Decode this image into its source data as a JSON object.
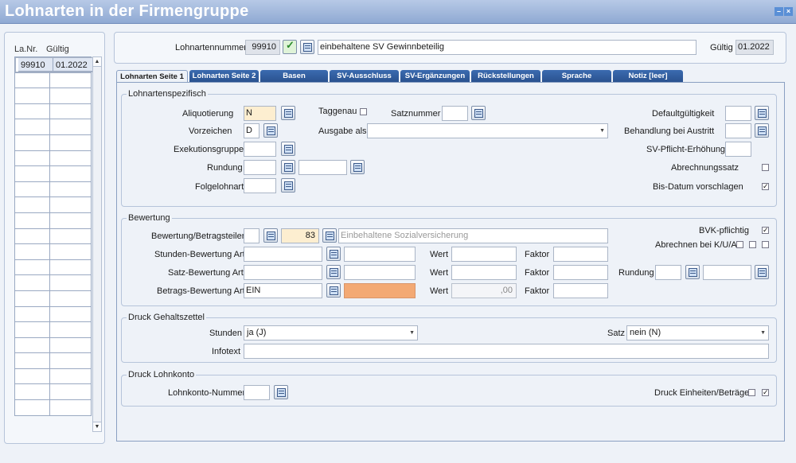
{
  "window": {
    "title": "Lohnarten in der Firmengruppe",
    "controls": [
      "–",
      "×"
    ]
  },
  "list": {
    "col1": "La.Nr.",
    "col2": "Gültig",
    "rows": [
      {
        "nr": "99910",
        "valid": "01.2022"
      }
    ]
  },
  "header": {
    "lohnartennummer_label": "Lohnartennummer",
    "nummer": "99910",
    "bezeichnung": "einbehaltene SV Gewinnbeteilig",
    "gueltig_label": "Gültig",
    "gueltig": "01.2022"
  },
  "tabs": [
    "Lohnarten Seite 1",
    "Lohnarten Seite 2",
    "Basen",
    "SV-Ausschluss",
    "SV-Ergänzungen",
    "Rückstellungen",
    "Sprache",
    "Notiz [leer]"
  ],
  "spez": {
    "title": "Lohnartenspezifisch",
    "aliquotierung_label": "Aliquotierung",
    "aliquotierung": "N",
    "vorzeichen_label": "Vorzeichen",
    "vorzeichen": "D",
    "exekution_label": "Exekutionsgruppe",
    "rundung_label": "Rundung",
    "folgelohnart_label": "Folgelohnart",
    "taggenau_label": "Taggenau",
    "satznummer_label": "Satznummer",
    "ausgabe_label": "Ausgabe als",
    "default_label": "Defaultgültigkeit",
    "austritt_label": "Behandlung bei Austritt",
    "svpflicht_label": "SV-Pflicht-Erhöhung",
    "abrechnungssatz_label": "Abrechnungssatz",
    "bisdatum_label": "Bis-Datum vorschlagen"
  },
  "bewertung": {
    "title": "Bewertung",
    "betragsteiler_label": "Bewertung/Betragsteiler",
    "betragsteiler_val": "83",
    "betragsteiler_text": "Einbehaltene Sozialversicherung",
    "stunden_label": "Stunden-Bewertung Art",
    "satz_label": "Satz-Bewertung Art",
    "betrags_label": "Betrags-Bewertung Art",
    "betrags_val": "EIN",
    "wert_label": "Wert",
    "faktor_label": "Faktor",
    "wert3": ",00",
    "bvk_label": "BVK-pflichtig",
    "kua_label": "Abrechnen bei K/U/A",
    "rundung_label": "Rundung"
  },
  "druck": {
    "title": "Druck Gehaltszettel",
    "stunden_label": "Stunden",
    "stunden": "ja (J)",
    "satz_label": "Satz",
    "satz": "nein (N)",
    "infotext_label": "Infotext"
  },
  "lohnkonto": {
    "title": "Druck Lohnkonto",
    "nummer_label": "Lohnkonto-Nummer",
    "einheiten_label": "Druck Einheiten/Beträge"
  }
}
